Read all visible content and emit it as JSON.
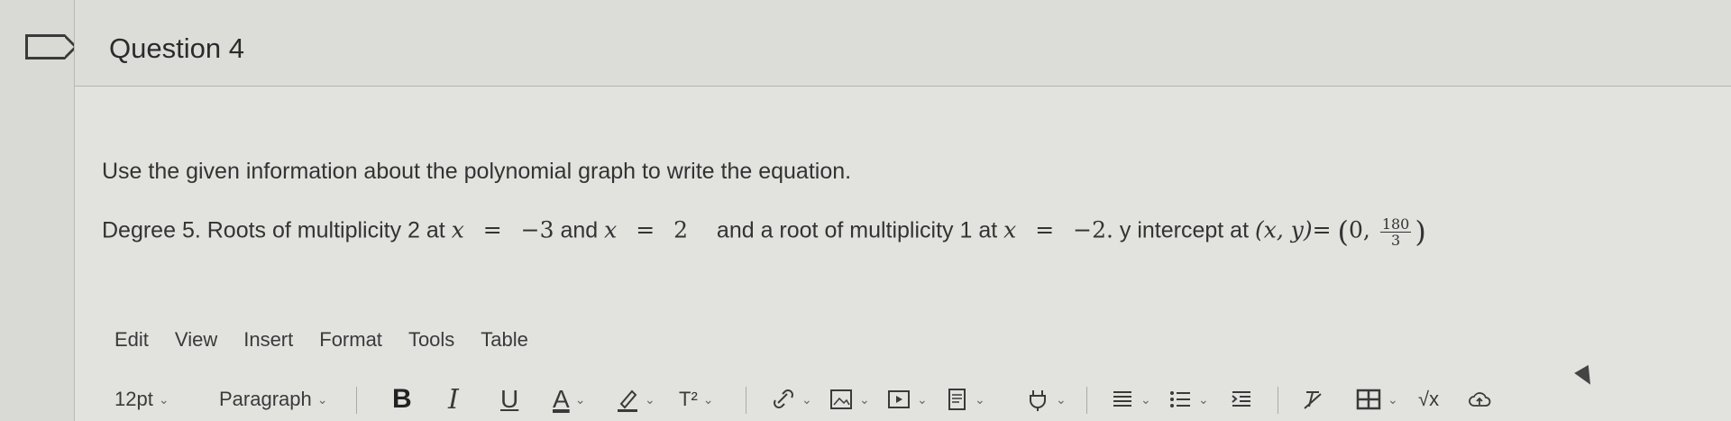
{
  "question": {
    "title": "Question 4",
    "prompt": "Use the given information about the polynomial graph to write the equation.",
    "line_parts": {
      "p1": "Degree 5. Roots of multiplicity 2 at",
      "x": "x",
      "eq": "=",
      "v1": "−3",
      "and": "and",
      "v2": "2",
      "p2": "and a root of multiplicity 1 at",
      "v3": "−2.",
      "p3": "y intercept at",
      "xy": "(x, y)",
      "point_x": "0,",
      "frac_num": "180",
      "frac_den": "3"
    }
  },
  "editor": {
    "menu": [
      "Edit",
      "View",
      "Insert",
      "Format",
      "Tools",
      "Table"
    ],
    "font_size": "12pt",
    "block_format": "Paragraph",
    "bold": "B",
    "italic": "I",
    "underline": "U",
    "font_color": "A",
    "superscript": "T²",
    "sqrt": "√x"
  }
}
